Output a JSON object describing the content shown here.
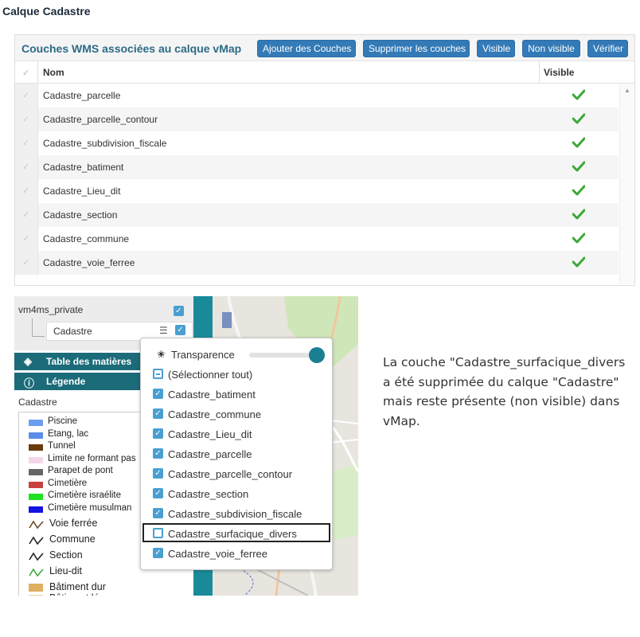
{
  "page_title": "Calque Cadastre",
  "wms_panel": {
    "title": "Couches WMS associées au calque vMap",
    "buttons": {
      "add": "Ajouter des Couches",
      "remove": "Supprimer les couches",
      "visible": "Visible",
      "not_visible": "Non visible",
      "verify": "Vérifier"
    },
    "columns": {
      "name": "Nom",
      "visible": "Visible"
    },
    "rows": [
      {
        "name": "Cadastre_parcelle"
      },
      {
        "name": "Cadastre_parcelle_contour"
      },
      {
        "name": "Cadastre_subdivision_fiscale"
      },
      {
        "name": "Cadastre_batiment"
      },
      {
        "name": "Cadastre_Lieu_dit"
      },
      {
        "name": "Cadastre_section"
      },
      {
        "name": "Cadastre_commune"
      },
      {
        "name": "Cadastre_voie_ferree"
      }
    ]
  },
  "layer_tree": {
    "group": "vm4ms_private",
    "layer": "Cadastre"
  },
  "menus": {
    "toc": "Table des matières",
    "legend": "Légende"
  },
  "legend": {
    "title": "Cadastre",
    "items": [
      {
        "label": "Piscine",
        "color": "#6b9cf0"
      },
      {
        "label": "Etang, lac",
        "color": "#5b8ce8"
      },
      {
        "label": "Tunnel",
        "color": "#6b3a0e"
      },
      {
        "label": "Limite ne formant pas",
        "color": "#f4d6e8"
      },
      {
        "label": "Parapet de pont",
        "color": "#666666"
      },
      {
        "label": "Cimetière",
        "color": "#c94040"
      },
      {
        "label": "Cimetière israélite",
        "color": "#22e022"
      },
      {
        "label": "Cimetière musulman",
        "color": "#1414e0"
      }
    ],
    "lines": [
      {
        "label": "Voie ferrée",
        "color": "#6b4a2a"
      },
      {
        "label": "Commune",
        "color": "#222222"
      },
      {
        "label": "Section",
        "color": "#222222"
      },
      {
        "label": "Lieu-dit",
        "color": "#3aaa3a"
      }
    ],
    "extra": [
      {
        "label": "Bâtiment dur",
        "color": "#e0b060"
      },
      {
        "label": "Bâtiment léger",
        "color": "#f0d0a0"
      }
    ]
  },
  "popup": {
    "transparency": "Transparence",
    "transparency_value": 1.0,
    "select_all": "(Sélectionner tout)",
    "items": [
      {
        "label": "Cadastre_batiment",
        "checked": true
      },
      {
        "label": "Cadastre_commune",
        "checked": true
      },
      {
        "label": "Cadastre_Lieu_dit",
        "checked": true
      },
      {
        "label": "Cadastre_parcelle",
        "checked": true
      },
      {
        "label": "Cadastre_parcelle_contour",
        "checked": true
      },
      {
        "label": "Cadastre_section",
        "checked": true
      },
      {
        "label": "Cadastre_subdivision_fiscale",
        "checked": true
      },
      {
        "label": "Cadastre_surfacique_divers",
        "checked": false
      },
      {
        "label": "Cadastre_voie_ferree",
        "checked": true
      }
    ]
  },
  "note": "La couche \"Cadastre_surfacique_divers a été supprimée du calque \"Cadastre\" mais reste présente (non visible) dans vMap.",
  "colors": {
    "primary_button": "#337ab7",
    "panel_title": "#2c6b86",
    "menu_bar": "#1b6b79",
    "checkbox": "#4a9fd1",
    "check_green": "#3aa83a"
  }
}
